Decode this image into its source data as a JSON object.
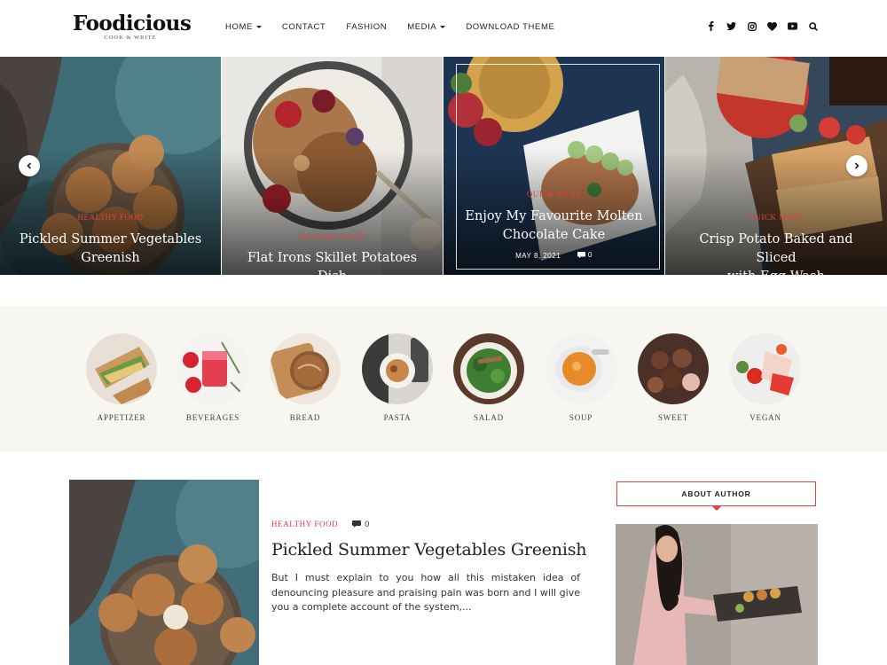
{
  "header": {
    "logo_title": "Foodicious",
    "logo_tagline": "COOK & WRITE",
    "nav": [
      {
        "label": "HOME",
        "has_dropdown": true
      },
      {
        "label": "CONTACT",
        "has_dropdown": false
      },
      {
        "label": "FASHION",
        "has_dropdown": false
      },
      {
        "label": "MEDIA",
        "has_dropdown": true
      },
      {
        "label": "DOWNLOAD THEME",
        "has_dropdown": false
      }
    ],
    "social_icons": [
      "facebook-icon",
      "twitter-icon",
      "instagram-icon",
      "heart-icon",
      "youtube-icon",
      "search-icon"
    ]
  },
  "slider": {
    "slides": [
      {
        "category": "HEALTHY FOOD",
        "title_line1": "Pickled Summer Vegetables",
        "title_line2": "Greenish"
      },
      {
        "category": "HEALTHY FOOD",
        "title_line1": "Flat Irons Skillet Potatoes Dish",
        "title_line2": ""
      },
      {
        "category": "QUICK MEAL",
        "title_line1": "Enjoy My Favourite Molten",
        "title_line2": "Chocolate Cake",
        "date": "MAY 8, 2021",
        "comments": "0"
      },
      {
        "category": "QUICK MEAL",
        "title_line1": "Crisp Potato Baked and Sliced",
        "title_line2": "with Egg Wash"
      }
    ]
  },
  "categories": [
    {
      "label": "APPETIZER"
    },
    {
      "label": "BEVERAGES"
    },
    {
      "label": "BREAD"
    },
    {
      "label": "PASTA"
    },
    {
      "label": "SALAD"
    },
    {
      "label": "SOUP"
    },
    {
      "label": "SWEET"
    },
    {
      "label": "VEGAN"
    }
  ],
  "post": {
    "category": "HEALTHY FOOD",
    "comments": "0",
    "title": "Pickled Summer Vegetables Greenish",
    "excerpt": "But I must explain to you how all this mistaken idea of denouncing pleasure and praising pain was born and I will give you a complete account of the system,..."
  },
  "sidebar": {
    "widget_title": "ABOUT AUTHOR"
  },
  "colors": {
    "accent": "#e2413d",
    "category_band": "#f8f6f1"
  }
}
